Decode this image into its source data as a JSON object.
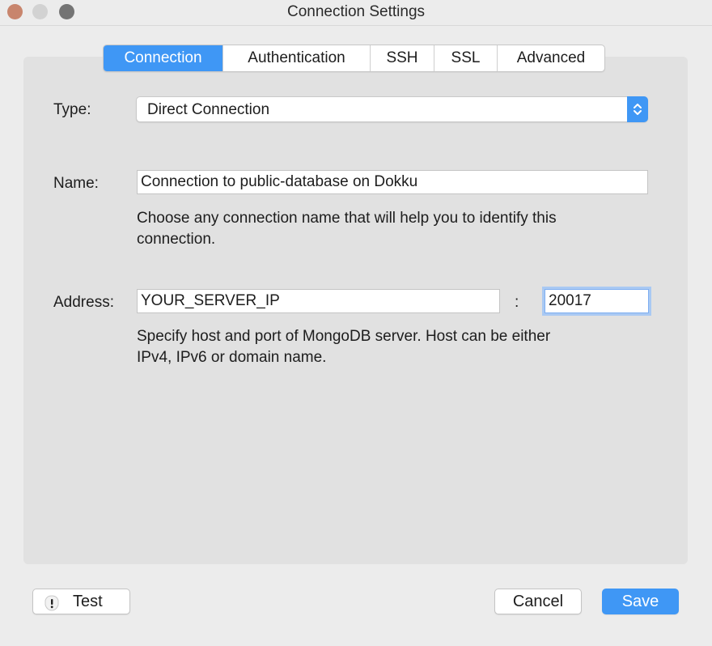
{
  "window": {
    "title": "Connection Settings"
  },
  "tabs": [
    {
      "label": "Connection",
      "active": true
    },
    {
      "label": "Authentication",
      "active": false
    },
    {
      "label": "SSH",
      "active": false
    },
    {
      "label": "SSL",
      "active": false
    },
    {
      "label": "Advanced",
      "active": false
    }
  ],
  "form": {
    "type_label": "Type:",
    "type_value": "Direct Connection",
    "name_label": "Name:",
    "name_value": "Connection to public-database on Dokku",
    "name_help_line1": "Choose any connection name that will help you to identify this",
    "name_help_line2": "connection.",
    "address_label": "Address:",
    "host_value": "YOUR_SERVER_IP",
    "port_separator": ":",
    "port_value": "20017",
    "address_help_line1": "Specify host and port of MongoDB server. Host can be either",
    "address_help_line2": "IPv4, IPv6 or domain name."
  },
  "buttons": {
    "test": "Test",
    "cancel": "Cancel",
    "save": "Save"
  },
  "colors": {
    "accent": "#3f97f5",
    "panel": "#e1e1e1",
    "window": "#ececec"
  },
  "icons": {
    "test": "warning-icon",
    "type_select": "updown-chevron-icon"
  }
}
